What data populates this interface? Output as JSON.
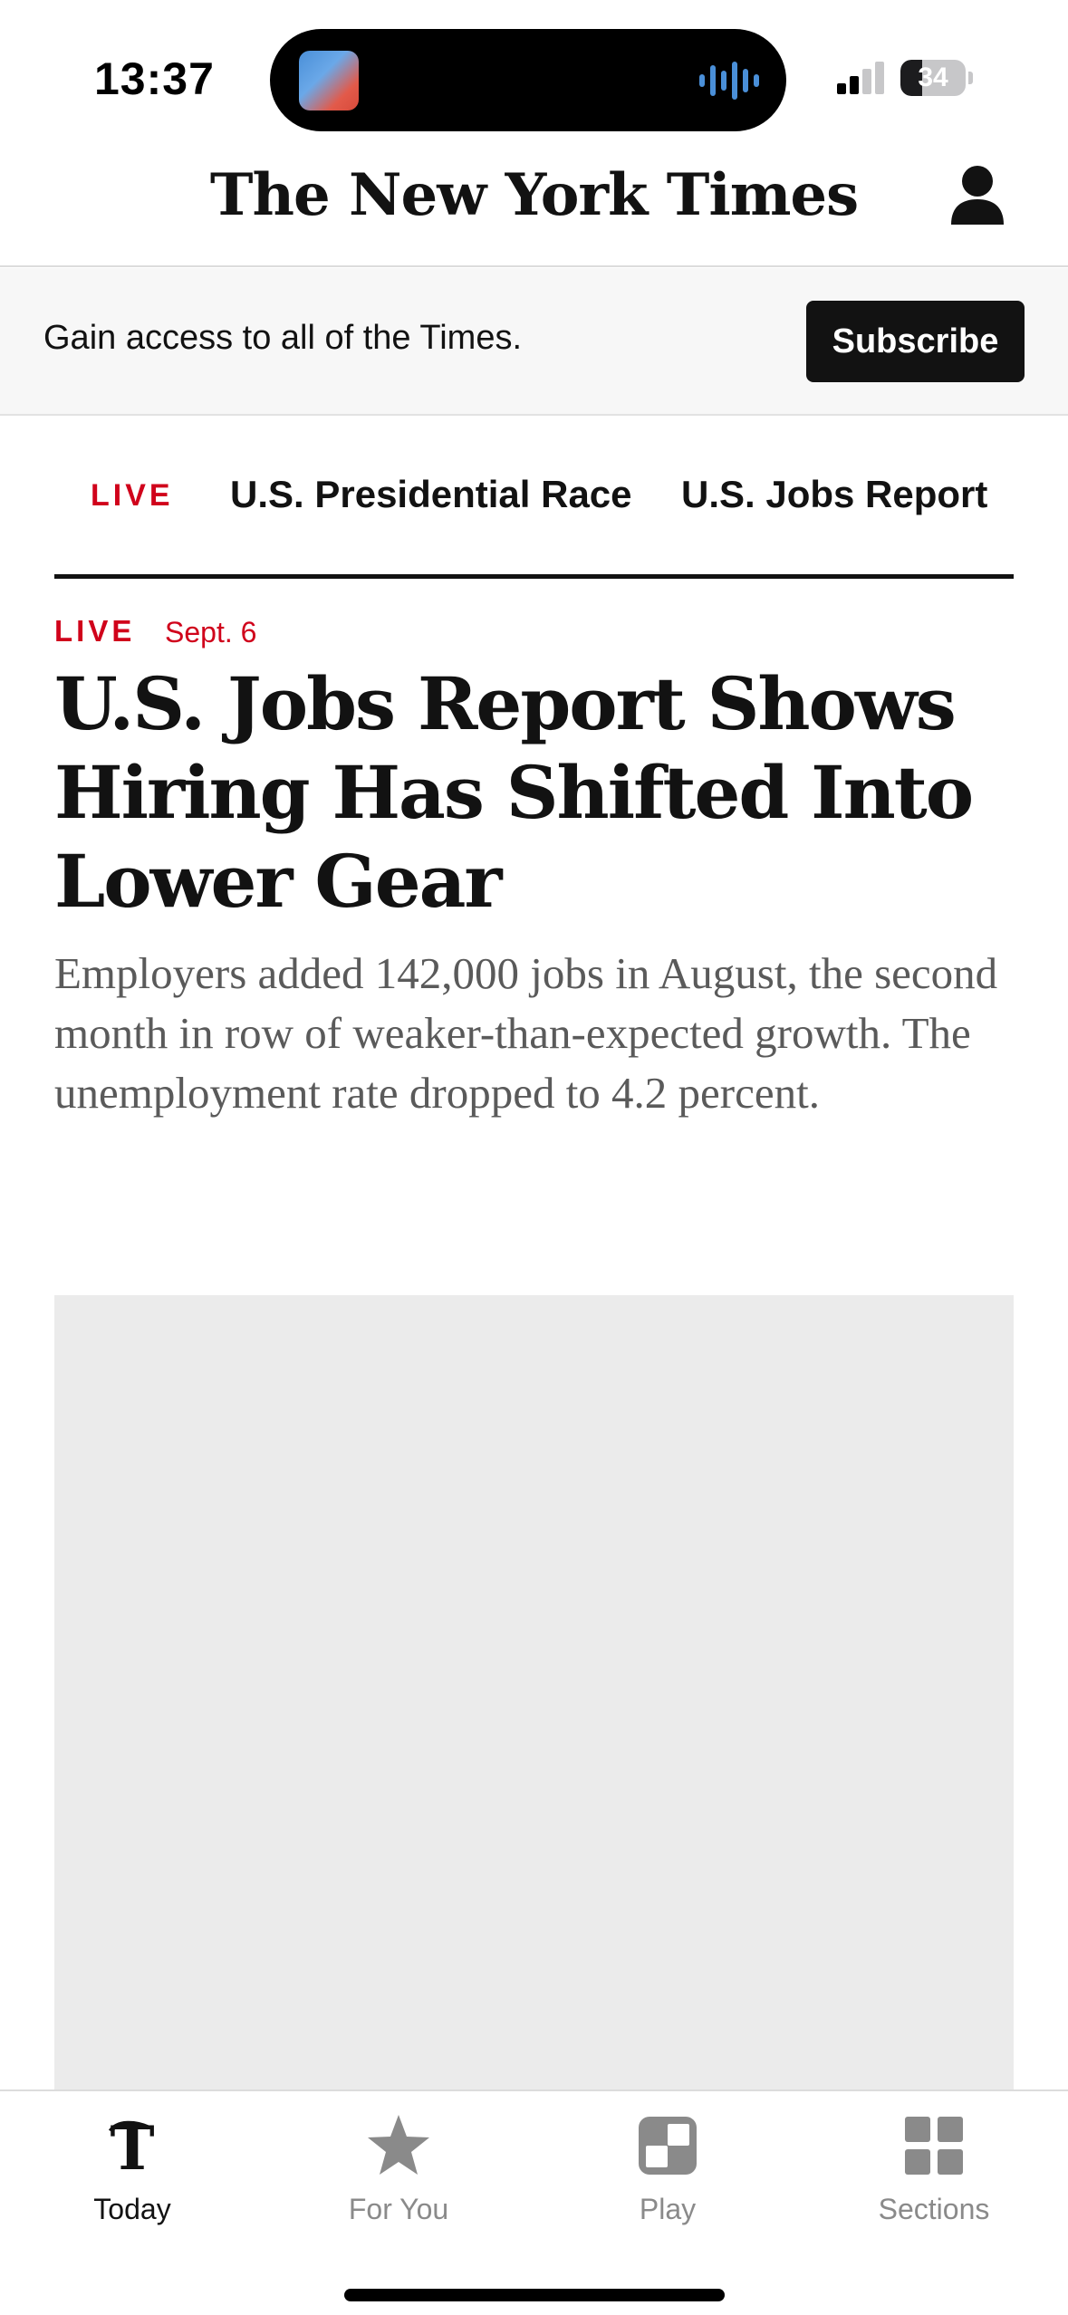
{
  "status_bar": {
    "time": "13:37",
    "battery_level": "34",
    "battery_fraction": 0.34,
    "signal_bars_active": 2,
    "island_icons": [
      "now-playing-artwork",
      "audio-waveform-icon"
    ]
  },
  "masthead": {
    "logo": "The New York Times",
    "account_icon": "person-icon"
  },
  "subscribe_banner": {
    "text": "Gain access to all of the Times.",
    "button_label": "Subscribe"
  },
  "topic_nav": {
    "live_label": "LIVE",
    "items": [
      "U.S. Presidential Race",
      "U.S. Jobs Report"
    ]
  },
  "article": {
    "live_label": "LIVE",
    "date": "Sept. 6",
    "headline": "U.S. Jobs Report Shows Hiring Has Shifted Into Lower Gear",
    "summary": "Employers added 142,000 jobs in August, the second month in row of weaker-than-expected growth. The unemployment rate dropped to 4.2 percent."
  },
  "tab_bar": {
    "tabs": [
      {
        "label": "Today",
        "icon": "nyt-t-logo-icon",
        "active": true
      },
      {
        "label": "For You",
        "icon": "star-icon",
        "active": false
      },
      {
        "label": "Play",
        "icon": "play-games-icon",
        "active": false
      },
      {
        "label": "Sections",
        "icon": "grid-icon",
        "active": false
      }
    ]
  },
  "colors": {
    "accent_live": "#d0021b",
    "text_primary": "#121212",
    "text_secondary": "#5a5a5a",
    "banner_bg": "#f7f7f7",
    "placeholder_bg": "#ebebeb"
  }
}
